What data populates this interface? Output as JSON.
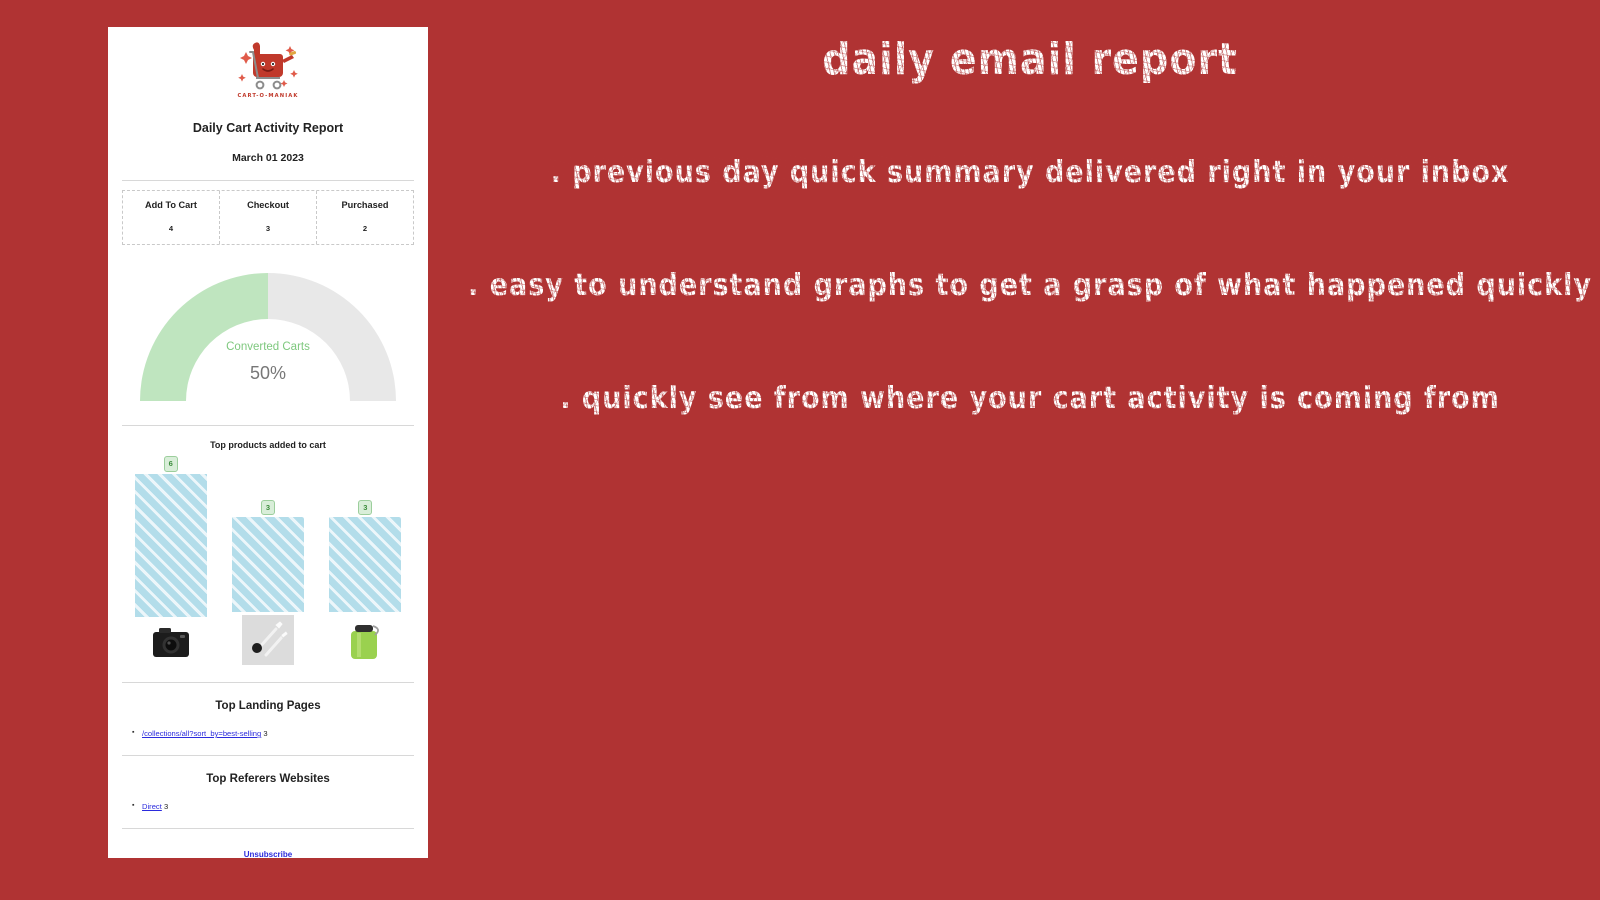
{
  "background_color": "#b03333",
  "email": {
    "logo": {
      "name": "cart-o-maniak-logo",
      "wordmark": "CART-O-MANIAK",
      "color": "#c0392b"
    },
    "title": "Daily Cart Activity Report",
    "date": "March 01 2023",
    "stats": {
      "headers": [
        "Add To Cart",
        "Checkout",
        "Purchased"
      ],
      "values": [
        "4",
        "3",
        "2"
      ]
    },
    "gauge": {
      "caption": "Converted Carts",
      "value_label": "50%",
      "percent": 50,
      "fill_color": "#bfe5bf",
      "track_color": "#e6e6e6",
      "caption_color": "#7ec87e"
    },
    "bar_chart_title": "Top products added to cart",
    "landing": {
      "title": "Top Landing Pages",
      "items": [
        {
          "label": "/collections/all?sort_by=best-selling",
          "count": "3"
        }
      ]
    },
    "referers": {
      "title": "Top Referers Websites",
      "items": [
        {
          "label": "Direct",
          "count": "3"
        }
      ]
    },
    "unsubscribe": "Unsubscribe"
  },
  "promo": {
    "heading": "Daily email report",
    "lines": [
      ". Previous day quick summary delivered right in your inbox",
      ". Easy to understand graphs to get a grasp of what happened quickly",
      ". Quickly see from where your cart activity is coming from"
    ]
  },
  "chart_data": {
    "type": "bar",
    "title": "Top products added to cart",
    "categories": [
      "camera",
      "kitchen-utensils",
      "green-water-bottle"
    ],
    "values": [
      6,
      3,
      3
    ],
    "xlabel": "",
    "ylabel": "",
    "ylim": [
      0,
      6
    ],
    "grid": false,
    "legend": "none",
    "bar_color": "#b3ddea",
    "label_badge_color": "#d9eed9",
    "label_text_color": "#3c8c3c"
  }
}
